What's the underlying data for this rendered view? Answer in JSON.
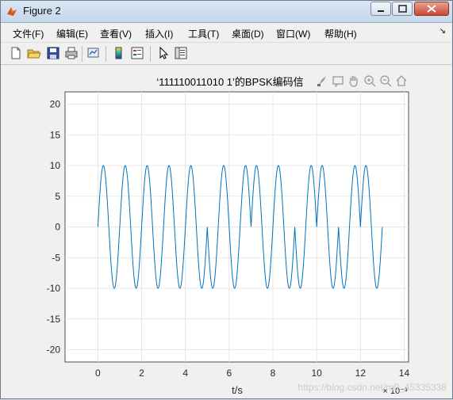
{
  "window": {
    "title": "Figure 2",
    "colors": {
      "titlebar": "#c6d6ea",
      "close": "#c74a33",
      "figure_bg": "#f0f0f0",
      "plot_bg": "#ffffff",
      "line": "#0072bd"
    }
  },
  "menu": {
    "items": [
      {
        "label": "文件(F)",
        "name": "menu-file"
      },
      {
        "label": "编辑(E)",
        "name": "menu-edit"
      },
      {
        "label": "查看(V)",
        "name": "menu-view"
      },
      {
        "label": "插入(I)",
        "name": "menu-insert"
      },
      {
        "label": "工具(T)",
        "name": "menu-tools"
      },
      {
        "label": "桌面(D)",
        "name": "menu-desktop"
      },
      {
        "label": "窗口(W)",
        "name": "menu-window"
      },
      {
        "label": "帮助(H)",
        "name": "menu-help"
      }
    ],
    "dock_arrow": "↘"
  },
  "toolbar": {
    "icons": [
      "new-figure-icon",
      "open-file-icon",
      "save-icon",
      "print-icon",
      "link-plot-icon",
      "colorbar-icon",
      "legend-icon",
      "edit-plot-icon",
      "property-inspector-icon"
    ]
  },
  "axes_toolbar": {
    "icons": [
      "brush-icon",
      "data-tips-icon",
      "pan-icon",
      "zoom-in-icon",
      "zoom-out-icon",
      "home-icon"
    ]
  },
  "chart_data": {
    "type": "line",
    "title": "‘111110011010 1’的BPSK编码信",
    "xlabel": "t/s",
    "ylabel": "",
    "xlim": [
      -1.5,
      14.2
    ],
    "ylim": [
      -22,
      22
    ],
    "x_scale_label": "× 10⁻³",
    "x_ticks": [
      0,
      2,
      4,
      6,
      8,
      10,
      12,
      14
    ],
    "y_ticks": [
      -20,
      -15,
      -10,
      -5,
      0,
      5,
      10,
      15,
      20
    ],
    "grid": true,
    "series": [
      {
        "amplitude": 10,
        "carrier_frequency_hz": 1000,
        "bit_duration_ms": 1,
        "bits": [
          1,
          1,
          1,
          1,
          1,
          0,
          0,
          1,
          1,
          0,
          1,
          0,
          1
        ],
        "t_range_ms": [
          0,
          13
        ],
        "formula": "y = A * sin(2*pi*f*t) * (2*b-1)"
      }
    ],
    "watermark": "https://blog.csdn.net/m0_45335338"
  }
}
